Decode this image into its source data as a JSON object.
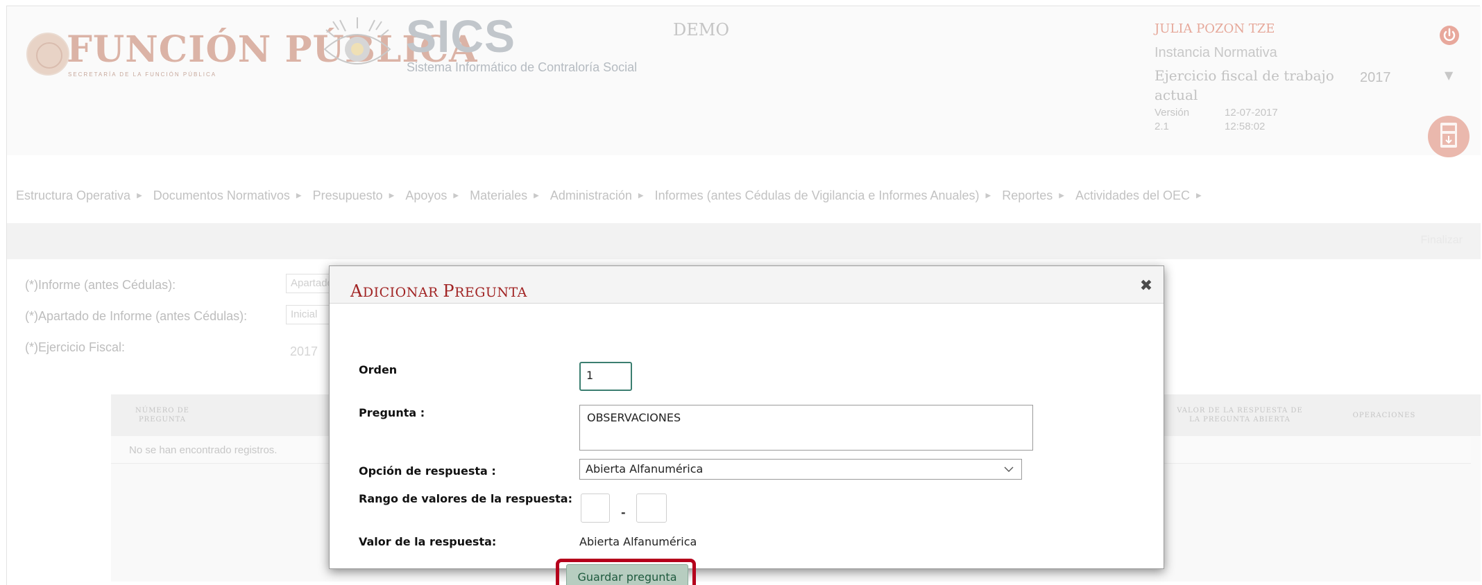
{
  "header": {
    "brand_main": "FUNCIÓN PÚBLICA",
    "brand_sub": "SECRETARÍA DE LA FUNCIÓN PÚBLICA",
    "app_name": "SICS",
    "app_full_name": "Sistema Informático de Contraloría Social",
    "environment": "DEMO",
    "user": {
      "name": "JULIA POZON TZE",
      "role": "Instancia Normativa",
      "fiscal_year_label": "Ejercicio fiscal de trabajo actual",
      "fiscal_year_value": "2017",
      "version_label": "Versión",
      "version_number": "2.1",
      "version_date": "12-07-2017",
      "version_time": "12:58:02"
    }
  },
  "nav": {
    "items": [
      {
        "label": "Estructura Operativa"
      },
      {
        "label": "Documentos Normativos"
      },
      {
        "label": "Presupuesto"
      },
      {
        "label": "Apoyos"
      },
      {
        "label": "Materiales"
      },
      {
        "label": "Administración"
      },
      {
        "label": "Informes (antes Cédulas de Vigilancia e Informes Anuales)"
      },
      {
        "label": "Reportes"
      },
      {
        "label": "Actividades del OEC"
      }
    ]
  },
  "toolbar": {
    "finalizar_label": "Finalizar"
  },
  "background_form": {
    "informe_label": "(*)Informe (antes Cédulas):",
    "informe_value": "Apartado",
    "apartado_label": "(*)Apartado de Informe (antes Cédulas):",
    "apartado_value": "Inicial",
    "ejercicio_label": "(*)Ejercicio Fiscal:",
    "ejercicio_value": "2017"
  },
  "background_table": {
    "col_numero_line1": "NÚMERO DE",
    "col_numero_line2": "PREGUNTA",
    "col_valor_line1": "VALOR DE LA RESPUESTA DE",
    "col_valor_line2": "LA PREGUNTA ABIERTA",
    "col_operaciones": "OPERACIONES",
    "empty_message": "No se han encontrado registros."
  },
  "modal": {
    "title_first_a": "A",
    "title_rest_a": "DICIONAR ",
    "title_first_b": "P",
    "title_rest_b": "REGUNTA",
    "orden_label": "Orden",
    "orden_value": "1",
    "pregunta_label": "Pregunta :",
    "pregunta_value": "OBSERVACIONES",
    "opcion_label": "Opción de respuesta :",
    "opcion_value": "Abierta Alfanumérica",
    "rango_label": "Rango de valores de la respuesta:",
    "rango_separator": "-",
    "rango_min": "",
    "rango_max": "",
    "valor_label": "Valor de la respuesta:",
    "valor_value": "Abierta Alfanumérica",
    "save_label": "Guardar pregunta"
  },
  "colors": {
    "modal_title": "#a12424",
    "highlight": "#b5001c",
    "save_button_bg": "#b7cdc0",
    "save_button_text": "#1f5a3e",
    "orden_border": "#3b7e70"
  },
  "icons": {
    "close": "close-icon",
    "power": "power-icon",
    "pdf": "pdf-icon",
    "nav_arrow": "arrow-right-icon",
    "select_chevron": "chevron-down-icon"
  }
}
